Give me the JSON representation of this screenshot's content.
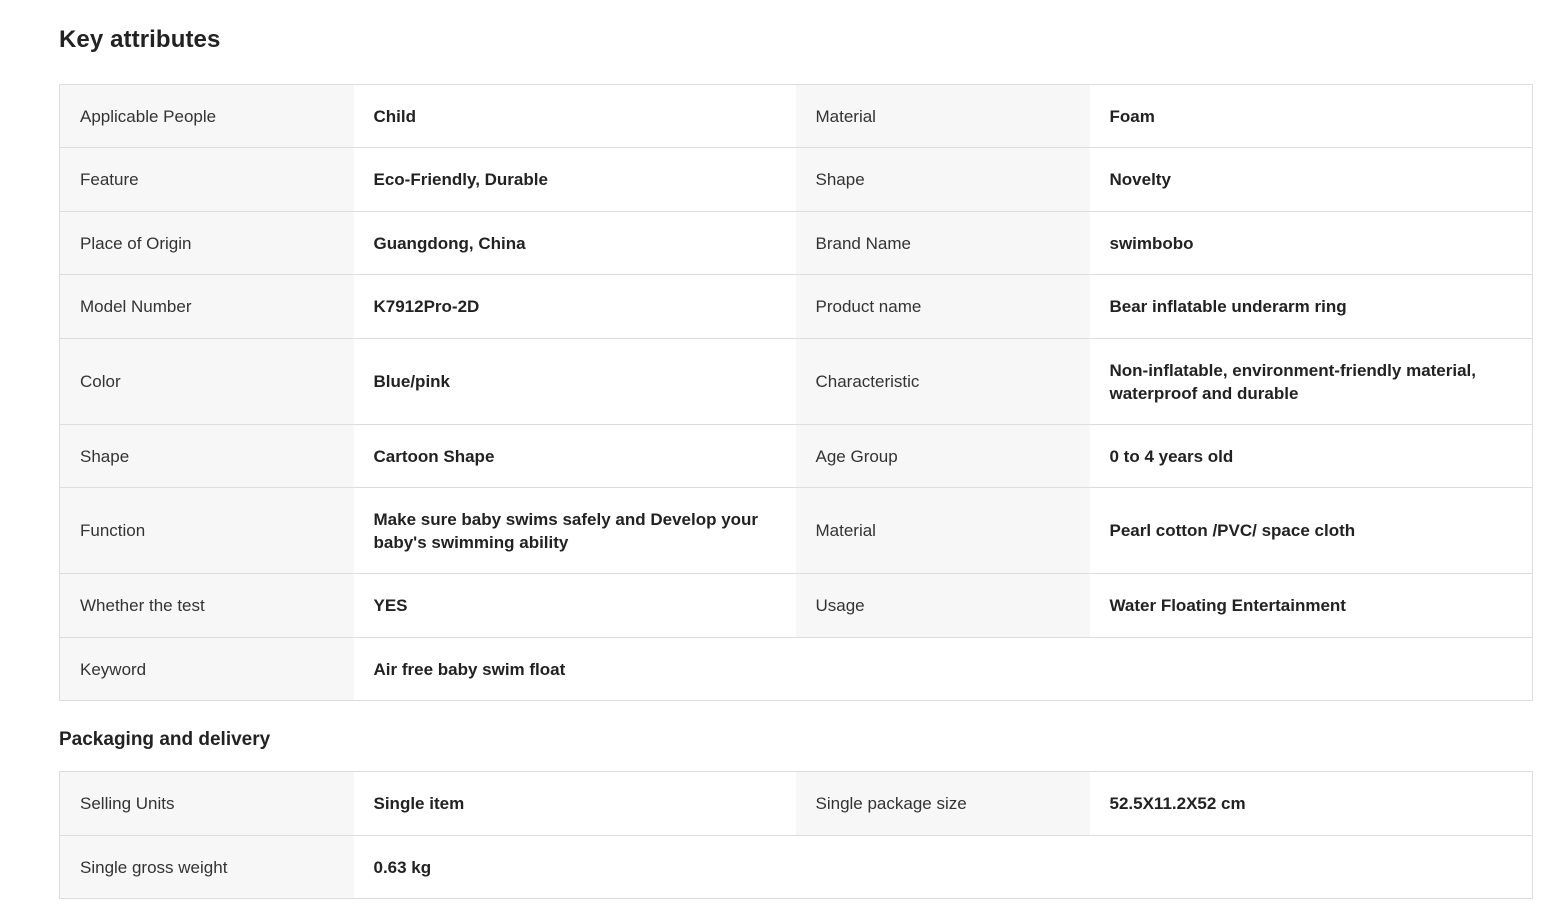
{
  "key_attributes": {
    "title": "Key attributes",
    "rows": [
      {
        "label1": "Applicable People",
        "value1": "Child",
        "label2": "Material",
        "value2": "Foam"
      },
      {
        "label1": "Feature",
        "value1": "Eco-Friendly, Durable",
        "label2": "Shape",
        "value2": "Novelty"
      },
      {
        "label1": "Place of Origin",
        "value1": "Guangdong, China",
        "label2": "Brand Name",
        "value2": "swimbobo"
      },
      {
        "label1": "Model Number",
        "value1": "K7912Pro-2D",
        "label2": "Product name",
        "value2": "Bear inflatable underarm ring"
      },
      {
        "label1": "Color",
        "value1": "Blue/pink",
        "label2": "Characteristic",
        "value2": "Non-inflatable, environment-friendly material, waterproof and durable"
      },
      {
        "label1": "Shape",
        "value1": "Cartoon Shape",
        "label2": "Age Group",
        "value2": "0 to 4 years old"
      },
      {
        "label1": "Function",
        "value1": "Make sure baby swims safely and Develop your baby's swimming ability",
        "label2": "Material",
        "value2": "Pearl cotton /PVC/ space cloth"
      },
      {
        "label1": "Whether the test",
        "value1": "YES",
        "label2": "Usage",
        "value2": "Water Floating Entertainment"
      },
      {
        "label1": "Keyword",
        "value1": "Air free baby swim float"
      }
    ]
  },
  "packaging": {
    "title": "Packaging and delivery",
    "rows": [
      {
        "label1": "Selling Units",
        "value1": "Single item",
        "label2": "Single package size",
        "value2": "52.5X11.2X52 cm"
      },
      {
        "label1": "Single gross weight",
        "value1": "0.63 kg"
      }
    ]
  },
  "colors": {
    "label_bg": "#f7f7f7",
    "value_bg": "#ffffff",
    "border": "#dddddd",
    "text": "#222222"
  }
}
